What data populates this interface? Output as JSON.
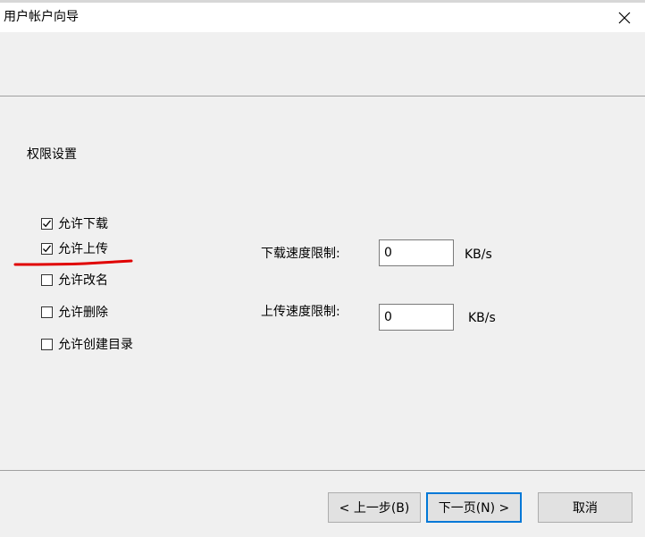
{
  "window": {
    "title": "用户帐户向导",
    "close_label": "关闭"
  },
  "section": {
    "title": "权限设置"
  },
  "permissions": [
    {
      "label": "允许下载",
      "checked": true
    },
    {
      "label": "允许上传",
      "checked": true
    },
    {
      "label": "允许改名",
      "checked": false
    },
    {
      "label": "允许删除",
      "checked": false
    },
    {
      "label": "允许创建目录",
      "checked": false
    }
  ],
  "limits": {
    "download": {
      "label": "下载速度限制:",
      "value": "0",
      "unit": "KB/s"
    },
    "upload": {
      "label": "上传速度限制:",
      "value": "0",
      "unit": "KB/s"
    }
  },
  "buttons": {
    "back": "< 上一步(B)",
    "next": "下一页(N) >",
    "cancel": "取消"
  },
  "colors": {
    "annotation": "#e00000",
    "focus_border": "#0078d7",
    "window_bg": "#f0f0f0"
  },
  "icons": {
    "close": "close-icon",
    "check": "checkmark-icon"
  }
}
